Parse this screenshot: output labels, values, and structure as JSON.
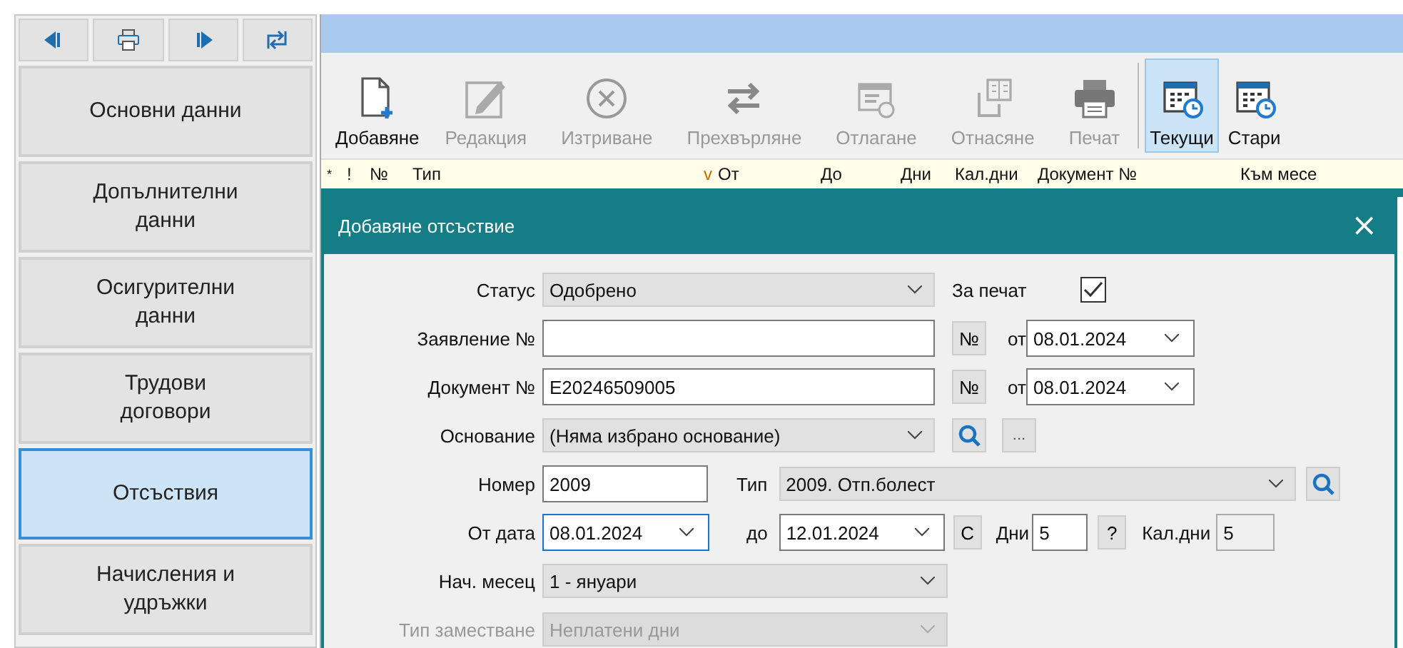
{
  "sidebar": {
    "items": [
      {
        "label": "Основни данни",
        "selected": false
      },
      {
        "label": "Допълнителни данни",
        "selected": false
      },
      {
        "label": "Осигурителни данни",
        "selected": false
      },
      {
        "label": "Трудови договори",
        "selected": false
      },
      {
        "label": "Отсъствия",
        "selected": true
      },
      {
        "label": "Начисления и удръжки",
        "selected": false
      }
    ]
  },
  "toolbar": {
    "buttons": [
      {
        "label": "Добавяне",
        "disabled": false,
        "selected": false
      },
      {
        "label": "Редакция",
        "disabled": true,
        "selected": false
      },
      {
        "label": "Изтриване",
        "disabled": true,
        "selected": false
      },
      {
        "label": "Прехвърляне",
        "disabled": true,
        "selected": false
      },
      {
        "label": "Отлагане",
        "disabled": true,
        "selected": false
      },
      {
        "label": "Отнасяне",
        "disabled": true,
        "selected": false
      },
      {
        "label": "Печат",
        "disabled": true,
        "selected": false
      },
      {
        "label": "Текущи",
        "disabled": false,
        "selected": true
      },
      {
        "label": "Стари",
        "disabled": false,
        "selected": false
      }
    ]
  },
  "grid": {
    "columns": [
      {
        "label": "*"
      },
      {
        "label": "!"
      },
      {
        "label": "№"
      },
      {
        "label": "Тип"
      },
      {
        "label": "От",
        "sort": "v"
      },
      {
        "label": "До"
      },
      {
        "label": "Дни"
      },
      {
        "label": "Кал.дни"
      },
      {
        "label": "Документ №"
      },
      {
        "label": "Към месе"
      }
    ]
  },
  "dialog": {
    "title": "Добавяне отсъствие",
    "close": "×",
    "status": {
      "label": "Статус",
      "value": "Одобрено"
    },
    "for_print": {
      "label": "За печат",
      "checked": true
    },
    "application": {
      "label": "Заявление №",
      "number_button": "№",
      "date_label": "от",
      "date": "08.01.2024"
    },
    "document": {
      "label": "Документ №",
      "value": "E20246509005",
      "number_button": "№",
      "date_label": "от",
      "date": "08.01.2024"
    },
    "basis": {
      "label": "Основание",
      "value": "(Няма избрано основание)",
      "more_button": "..."
    },
    "number": {
      "label": "Номер",
      "value": "2009"
    },
    "type": {
      "label": "Тип",
      "value": "2009. Отп.болест"
    },
    "from_date": {
      "label": "От дата",
      "value": "08.01.2024",
      "focused": true
    },
    "to_date": {
      "label": "до",
      "value": "12.01.2024",
      "focused": false
    },
    "calc_button": "C",
    "days": {
      "label": "Дни",
      "value": "5"
    },
    "help_button": "?",
    "calendar_days": {
      "label": "Кал.дни",
      "value": "5"
    },
    "start_month": {
      "label": "Нач. месец",
      "value": "1 - януари",
      "disabled": false
    },
    "substitution_type": {
      "label": "Тип заместване",
      "value": "Неплатени дни",
      "disabled": true
    }
  }
}
